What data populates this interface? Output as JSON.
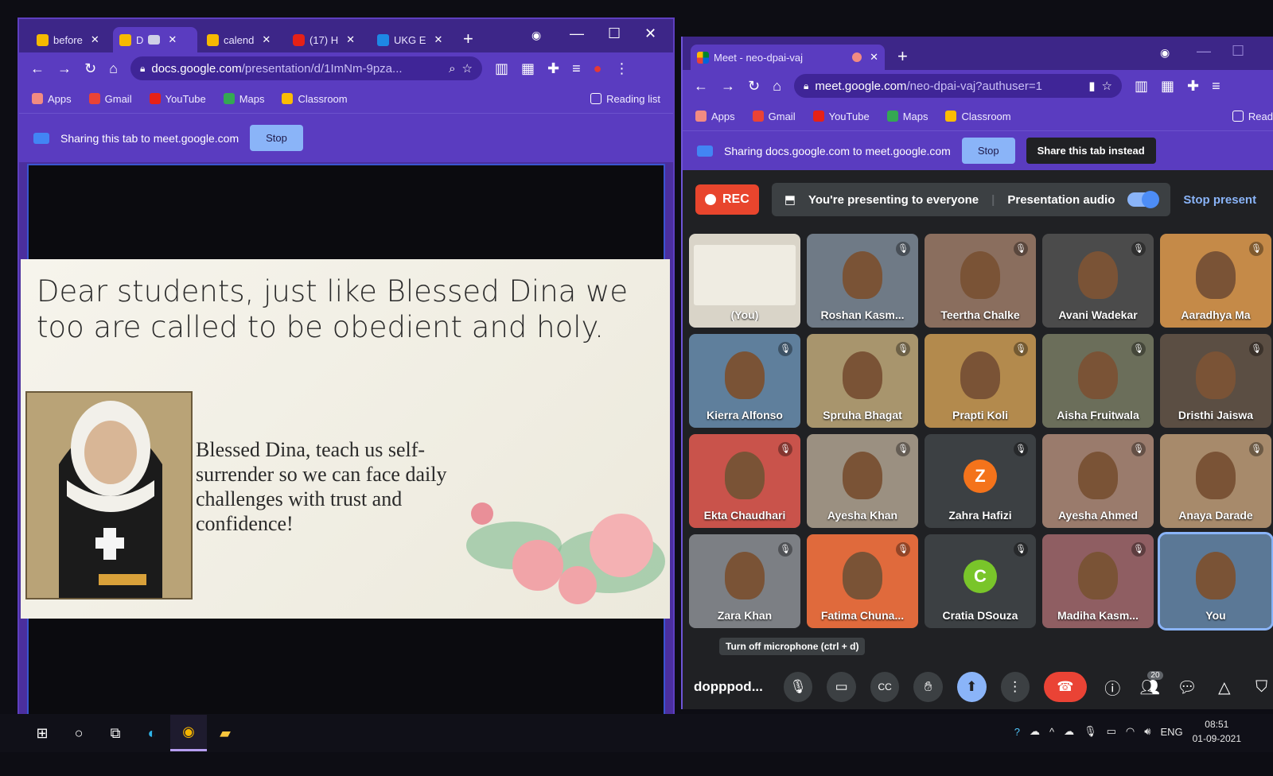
{
  "left_window": {
    "tabs": [
      {
        "label": "before",
        "icon": "slides-icon"
      },
      {
        "label": "D",
        "icon": "slides-icon"
      },
      {
        "label": "calend",
        "icon": "slides-icon"
      },
      {
        "label": "(17) H",
        "icon": "youtube-icon"
      },
      {
        "label": "UKG E",
        "icon": "classroom-icon"
      }
    ],
    "url": "docs.google.com",
    "url_path": "/presentation/d/1ImNm-9pza...",
    "bookmarks": [
      "Apps",
      "Gmail",
      "YouTube",
      "Maps",
      "Classroom"
    ],
    "reading_list": "Reading list",
    "share_text": "Sharing this tab to meet.google.com",
    "stop_label": "Stop",
    "slide": {
      "heading": "Dear students, just like Blessed Dina we too are called to be obedient and holy.",
      "prayer": "Blessed Dina, teach us self-surrender so we can face daily challenges with trust and confidence!"
    }
  },
  "right_window": {
    "tab_label": "Meet - neo-dpai-vaj",
    "url": "meet.google.com",
    "url_path": "/neo-dpai-vaj?authuser=1",
    "bookmarks": [
      "Apps",
      "Gmail",
      "YouTube",
      "Maps",
      "Classroom"
    ],
    "reading_list_partial": "Read",
    "share_text": "Sharing docs.google.com to meet.google.com",
    "stop_label": "Stop",
    "share_instead_label": "Share this tab instead",
    "rec_label": "REC",
    "presenting_text": "You're presenting to everyone",
    "presentation_audio": "Presentation audio",
    "stop_presenting": "Stop present",
    "participants": [
      {
        "name": "(You)",
        "type": "presentation",
        "color": "#d9d4c8"
      },
      {
        "name": "Roshan Kasm...",
        "type": "video",
        "color": "#6f7a86"
      },
      {
        "name": "Teertha Chalke",
        "type": "video",
        "color": "#8a6e5e"
      },
      {
        "name": "Avani Wadekar",
        "type": "video",
        "color": "#4b4b4b"
      },
      {
        "name": "Aaradhya Ma",
        "type": "video",
        "color": "#c58a48"
      },
      {
        "name": "Kierra Alfonso",
        "type": "video",
        "color": "#5f7f9c"
      },
      {
        "name": "Spruha Bhagat",
        "type": "video",
        "color": "#a8956d"
      },
      {
        "name": "Prapti Koli",
        "type": "video",
        "color": "#b38a4d"
      },
      {
        "name": "Aisha Fruitwala",
        "type": "video",
        "color": "#6b6e5a"
      },
      {
        "name": "Dristhi Jaiswa",
        "type": "video",
        "color": "#5b4e43"
      },
      {
        "name": "Ekta Chaudhari",
        "type": "video",
        "color": "#c9534b"
      },
      {
        "name": "Ayesha Khan",
        "type": "video",
        "color": "#9b9081"
      },
      {
        "name": "Zahra Hafizi",
        "type": "avatar",
        "letter": "Z",
        "color": "#f4731b"
      },
      {
        "name": "Ayesha Ahmed",
        "type": "video",
        "color": "#9a7b6c"
      },
      {
        "name": "Anaya Darade",
        "type": "video",
        "color": "#a78a6b"
      },
      {
        "name": "Zara Khan",
        "type": "video",
        "color": "#7c7f84"
      },
      {
        "name": "Fatima Chuna...",
        "type": "video",
        "color": "#e06a3c"
      },
      {
        "name": "Cratia DSouza",
        "type": "avatar",
        "letter": "C",
        "color": "#79c52a"
      },
      {
        "name": "Madiha Kasm...",
        "type": "video",
        "color": "#8f5e62"
      },
      {
        "name": "You",
        "type": "video",
        "color": "#5b7896"
      }
    ],
    "tooltip": "Turn off microphone (ctrl + d)",
    "meeting_code": "dopppod...",
    "participant_count": "20"
  },
  "taskbar": {
    "language": "ENG",
    "time": "08:51",
    "date": "01-09-2021"
  },
  "colors": {
    "chrome_theme": "#5a3cc0",
    "meet_background": "#202124",
    "rec_red": "#e8452d",
    "end_call_red": "#ea4335",
    "accent_blue": "#8ab4f8"
  }
}
